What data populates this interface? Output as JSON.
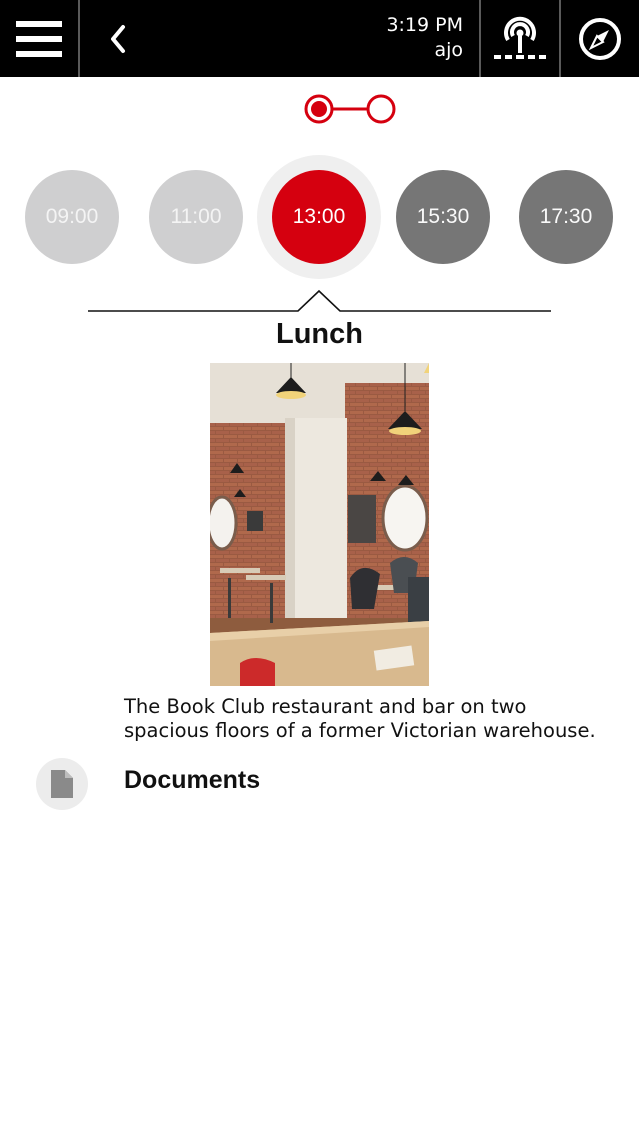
{
  "header": {
    "time": "3:19 PM",
    "user": "ajo",
    "icons": [
      "hamburger-menu-icon",
      "chevron-left-icon",
      "beacon-icon",
      "compass-icon"
    ]
  },
  "pager": {
    "total_pages": 2,
    "current_page": 1
  },
  "timeline": {
    "slots": [
      {
        "label": "09:00",
        "state": "past"
      },
      {
        "label": "11:00",
        "state": "past"
      },
      {
        "label": "13:00",
        "state": "current"
      },
      {
        "label": "15:30",
        "state": "upcoming"
      },
      {
        "label": "17:30",
        "state": "upcoming"
      }
    ]
  },
  "event": {
    "title": "Lunch",
    "description_line1": "The Book Club restaurant and bar on two",
    "description_line2": "spacious floors of a former Victorian warehouse."
  },
  "documents": {
    "label": "Documents",
    "icon": "document-icon"
  },
  "colors": {
    "accent": "#d5000f",
    "topbar": "#000000",
    "past_slot": "#cfcfd0",
    "upcoming_slot": "#767676"
  }
}
